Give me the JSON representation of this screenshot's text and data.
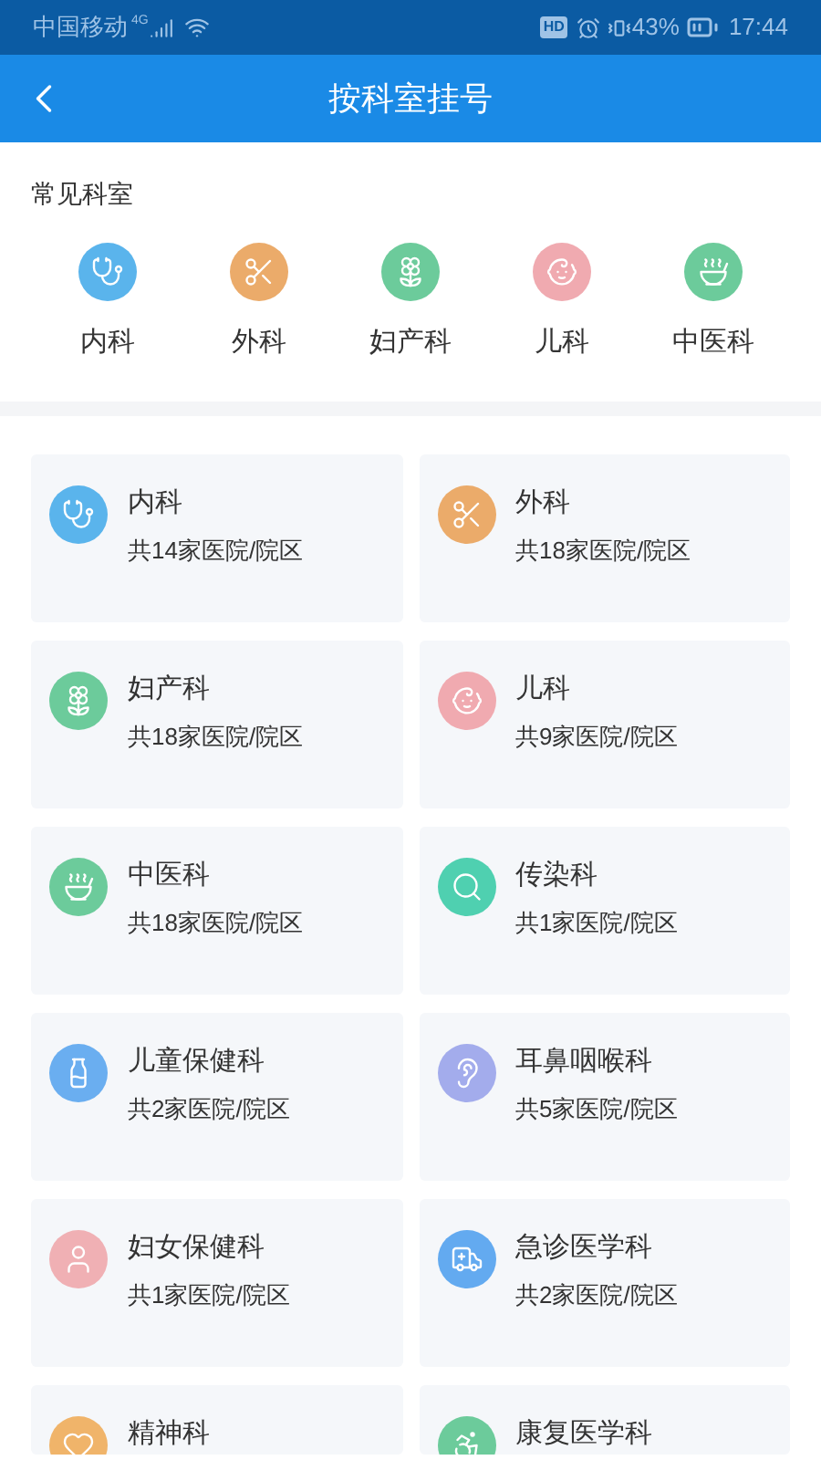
{
  "status_bar": {
    "carrier": "中国移动",
    "network": "4G",
    "hd": "HD",
    "battery": "43%",
    "time": "17:44"
  },
  "header": {
    "title": "按科室挂号"
  },
  "common": {
    "title": "常见科室",
    "items": [
      {
        "label": "内科",
        "color": "#5ab4ec"
      },
      {
        "label": "外科",
        "color": "#ebab6a"
      },
      {
        "label": "妇产科",
        "color": "#6ccb9b"
      },
      {
        "label": "儿科",
        "color": "#f0aab0"
      },
      {
        "label": "中医科",
        "color": "#6ccb9b"
      }
    ]
  },
  "departments": [
    {
      "name": "内科",
      "count": "共14家医院/院区",
      "color": "#5ab4ec"
    },
    {
      "name": "外科",
      "count": "共18家医院/院区",
      "color": "#ebab6a"
    },
    {
      "name": "妇产科",
      "count": "共18家医院/院区",
      "color": "#6ccb9b"
    },
    {
      "name": "儿科",
      "count": "共9家医院/院区",
      "color": "#f0aab0"
    },
    {
      "name": "中医科",
      "count": "共18家医院/院区",
      "color": "#6ccb9b"
    },
    {
      "name": "传染科",
      "count": "共1家医院/院区",
      "color": "#4fd0b0"
    },
    {
      "name": "儿童保健科",
      "count": "共2家医院/院区",
      "color": "#6aaef0"
    },
    {
      "name": "耳鼻咽喉科",
      "count": "共5家医院/院区",
      "color": "#a3acec"
    },
    {
      "name": "妇女保健科",
      "count": "共1家医院/院区",
      "color": "#f0b0b4"
    },
    {
      "name": "急诊医学科",
      "count": "共2家医院/院区",
      "color": "#63aaf0"
    },
    {
      "name": "精神科",
      "color": "#f0b46a"
    },
    {
      "name": "康复医学科",
      "color": "#6ccb9b"
    }
  ]
}
